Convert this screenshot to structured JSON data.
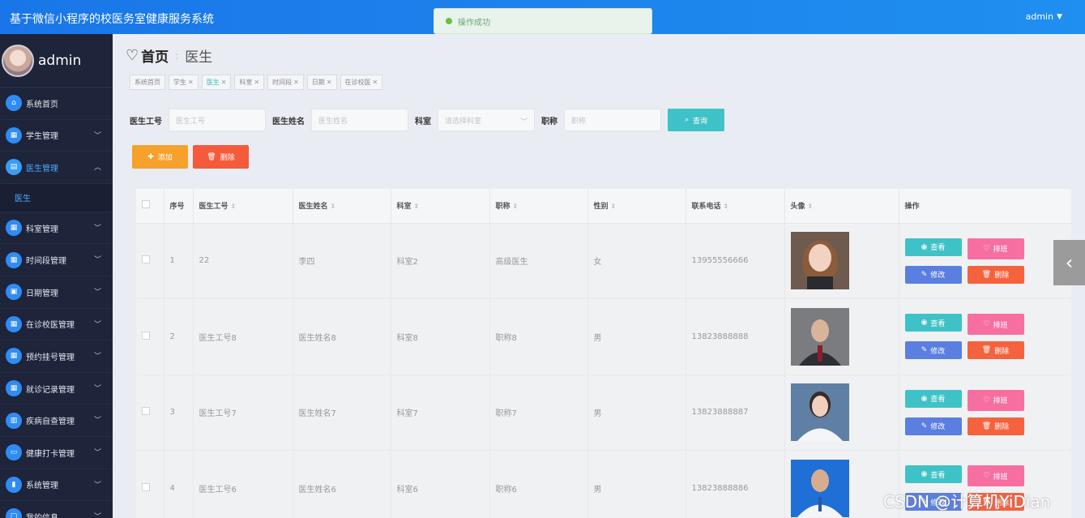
{
  "header": {
    "app_title": "基于微信小程序的校医务室健康服务系统",
    "user": "admin"
  },
  "toast": {
    "message": "操作成功"
  },
  "sidebar": {
    "username": "admin",
    "items": [
      {
        "label": "系统首页",
        "icon": "home-icon"
      },
      {
        "label": "学生管理",
        "icon": "grid-icon"
      },
      {
        "label": "医生管理",
        "icon": "chart-icon",
        "active": true,
        "sub": "医生"
      },
      {
        "label": "科室管理",
        "icon": "grid-icon"
      },
      {
        "label": "时间段管理",
        "icon": "grid-icon"
      },
      {
        "label": "日期管理",
        "icon": "calendar-icon"
      },
      {
        "label": "在诊校医管理",
        "icon": "grid-icon"
      },
      {
        "label": "预约挂号管理",
        "icon": "grid-icon"
      },
      {
        "label": "就诊记录管理",
        "icon": "grid-icon"
      },
      {
        "label": "疾病自查管理",
        "icon": "document-icon"
      },
      {
        "label": "健康打卡管理",
        "icon": "monitor-icon"
      },
      {
        "label": "系统管理",
        "icon": "bar-chart-icon"
      },
      {
        "label": "我的信息",
        "icon": "user-icon"
      }
    ]
  },
  "page": {
    "home": "首页",
    "current": "医生"
  },
  "tags": [
    "系统首页",
    "学生",
    "医生",
    "科室",
    "时间段",
    "日期",
    "在诊校医"
  ],
  "search": {
    "id_label": "医生工号",
    "id_placeholder": "医生工号",
    "name_label": "医生姓名",
    "name_placeholder": "医生姓名",
    "dept_label": "科室",
    "dept_placeholder": "请选择科室",
    "title_label": "职称",
    "title_placeholder": "职称",
    "query_button": "查询"
  },
  "actions": {
    "add": "添加",
    "delete": "删除"
  },
  "table": {
    "headers": [
      "序号",
      "医生工号",
      "医生姓名",
      "科室",
      "职称",
      "性别",
      "联系电话",
      "头像",
      "操作"
    ],
    "rows": [
      [
        "1",
        "22",
        "李四",
        "科室2",
        "高级医生",
        "女",
        "13955556666"
      ],
      [
        "2",
        "医生工号8",
        "医生姓名8",
        "科室8",
        "职称8",
        "男",
        "13823888888"
      ],
      [
        "3",
        "医生工号7",
        "医生姓名7",
        "科室7",
        "职称7",
        "男",
        "13823888887"
      ],
      [
        "4",
        "医生工号6",
        "医生姓名6",
        "科室6",
        "职称6",
        "男",
        "13823888886"
      ]
    ],
    "op_labels": {
      "view": "查看",
      "schedule": "排班",
      "edit": "修改",
      "delete": "删除"
    }
  },
  "watermark": "CSDN @计算机YiDian"
}
